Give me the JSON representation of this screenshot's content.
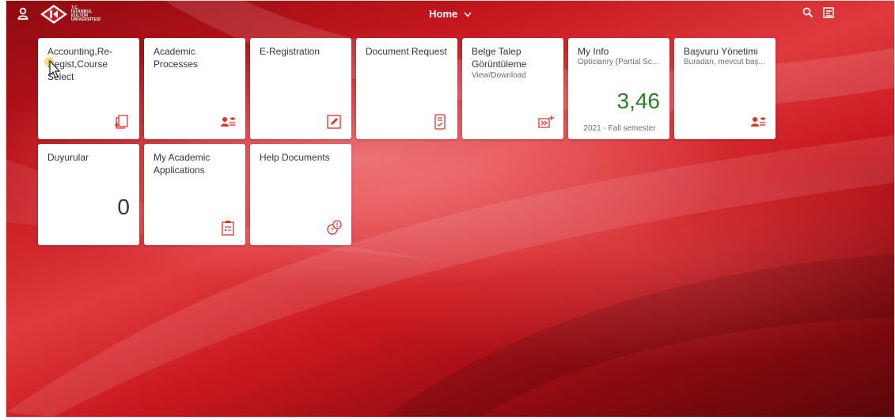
{
  "header": {
    "title": "Home",
    "logo_lines": [
      "T.C.",
      "İSTANBUL",
      "KÜLTÜR",
      "ÜNİVERSİTESİ"
    ],
    "icons": [
      "user-icon",
      "chevron-down-icon",
      "search-icon",
      "menu-icon"
    ]
  },
  "tiles": [
    {
      "title": "Accounting,Re-Regist,Course Select",
      "icon": "copy-add-icon"
    },
    {
      "title": "Academic Processes",
      "icon": "people-education-icon"
    },
    {
      "title": "E-Registration",
      "icon": "edit-icon"
    },
    {
      "title": "Document Request",
      "icon": "document-check-icon"
    },
    {
      "title": "Belge Talep Görüntüleme",
      "subtitle": "View/Download",
      "icon": "forward-add-icon"
    },
    {
      "title": "My Info",
      "subtitle": "Opticianry (Partial Sc...",
      "value": "3,46",
      "footer": "2021 - Fall semester"
    },
    {
      "title": "Başvuru Yönetimi",
      "subtitle": "Buradan, mevcut baş...",
      "icon": "people-education-icon"
    },
    {
      "title": "Duyurular",
      "value": "0"
    },
    {
      "title": "My Academic Applications",
      "icon": "clipboard-icon"
    },
    {
      "title": "Help Documents",
      "icon": "question-bubble-icon"
    }
  ],
  "colors": {
    "accent": "#e0332e",
    "kpi": "#2b7d2b",
    "background": "#c3161d"
  }
}
